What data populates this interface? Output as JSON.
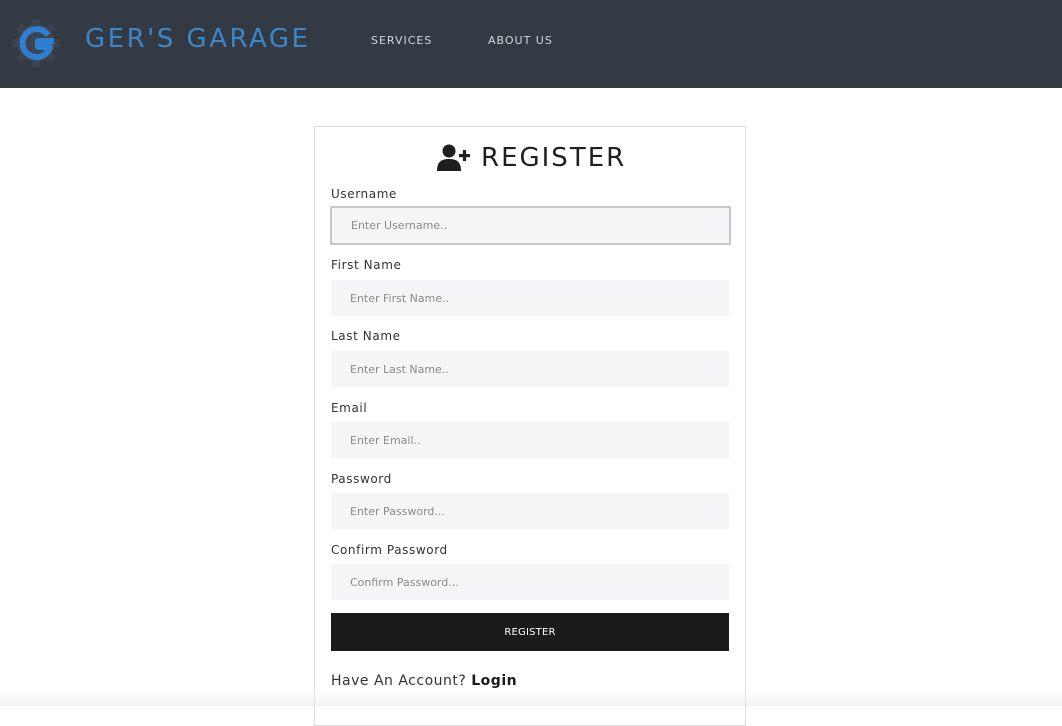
{
  "header": {
    "brand": "GER'S GARAGE",
    "logo_icon": "gear-g-logo-icon",
    "nav": [
      {
        "label": "SERVICES"
      },
      {
        "label": "ABOUT US"
      }
    ],
    "colors": {
      "background": "#343a44",
      "brand": "#3a86c8"
    }
  },
  "form": {
    "title": "REGISTER",
    "title_icon": "user-plus-icon",
    "fields": [
      {
        "label": "Username",
        "placeholder": "Enter Username..",
        "value": ""
      },
      {
        "label": "First Name",
        "placeholder": "Enter First Name..",
        "value": ""
      },
      {
        "label": "Last Name",
        "placeholder": "Enter Last Name..",
        "value": ""
      },
      {
        "label": "Email",
        "placeholder": "Enter Email..",
        "value": ""
      },
      {
        "label": "Password",
        "placeholder": "Enter Password...",
        "value": ""
      },
      {
        "label": "Confirm Password",
        "placeholder": "Confirm Password...",
        "value": ""
      }
    ],
    "submit_label": "REGISTER",
    "account_prompt": "Have An Account?",
    "login_label": "Login"
  }
}
